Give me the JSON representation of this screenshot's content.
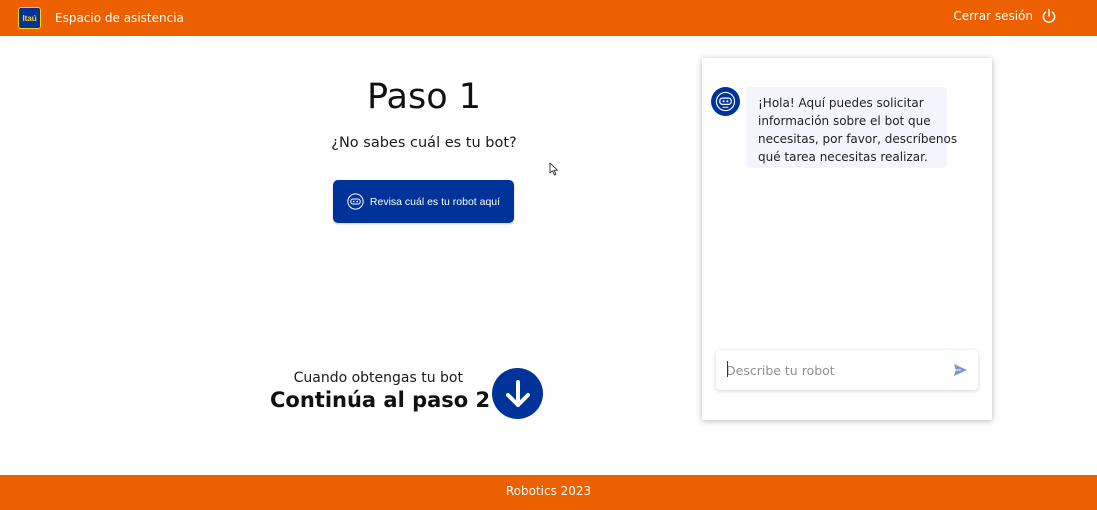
{
  "header": {
    "logo_text": "Itaú",
    "title": "Espacio de asistencia",
    "logout_label": "Cerrar sesión",
    "logout_icon": "power-icon",
    "background_color": "#ec6000"
  },
  "step": {
    "title": "Paso 1",
    "subtitle": "¿No sabes cuál es tu bot?",
    "button_label": "Revisa cuál es tu robot aquí",
    "button_icon": "robot-icon",
    "button_color": "#003399"
  },
  "next": {
    "subtitle": "Cuando obtengas tu bot",
    "title": "Continúa al paso 2",
    "icon": "arrow-down-icon"
  },
  "chat": {
    "avatar_icon": "robot-icon",
    "bot_message_lines": [
      "¡Hola! Aquí puedes solicitar",
      "información sobre el bot que",
      "necesitas, por favor, descríbenos",
      "qué tarea necesitas realizar."
    ],
    "input_value": "",
    "input_placeholder": "Describe tu robot",
    "send_icon": "send-icon"
  },
  "footer": {
    "text": "Robotics 2023"
  }
}
